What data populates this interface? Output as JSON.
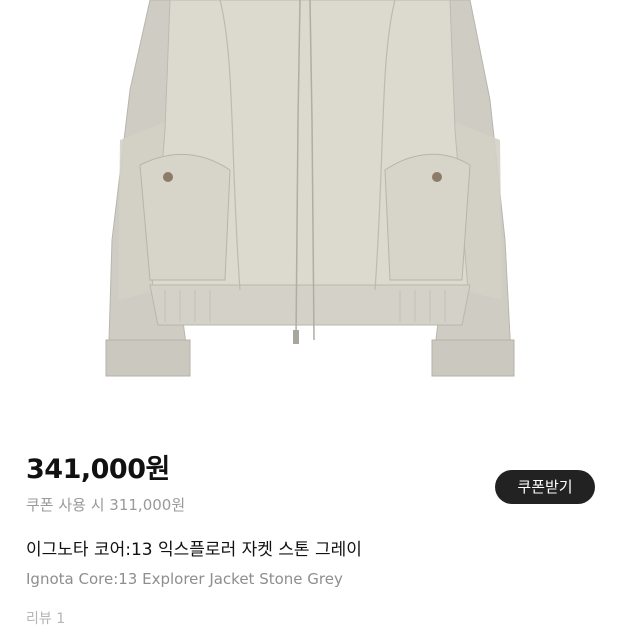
{
  "product": {
    "image_alt": "product-photo",
    "price": "341,000원",
    "coupon_price": "쿠폰 사용 시 311,000원",
    "coupon_button_label": "쿠폰받기",
    "title_ko": "이그노타 코어:13 익스플로러 자켓 스톤 그레이",
    "title_en": "Ignota Core:13 Explorer Jacket Stone Grey",
    "review_label": "리뷰 1"
  },
  "colors": {
    "jacket_body": "#d9d6cc",
    "jacket_sleeve": "#cfccc3",
    "button_bg": "#222222"
  }
}
